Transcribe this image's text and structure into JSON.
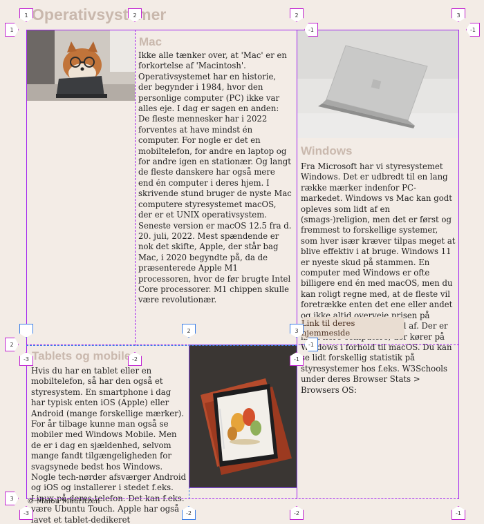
{
  "page": {
    "title": "Operativsystemer",
    "footer": "© Malou Mauritzen"
  },
  "mac": {
    "heading": "Mac",
    "text": "Ikke alle tænker over, at 'Mac' er en forkortelse af 'Macintosh'. Operativsystemet har en historie, der begynder i 1984, hvor den personlige computer (PC) ikke var alles eje. I dag er sagen en anden: De fleste mennesker har i 2022 forventes at have mindst én computer. For nogle er det en mobiltelefon, for andre en laptop og for andre igen en stationær. Og langt de fleste danskere har også mere end én computer i deres hjem. I skrivende stund bruger de nyste Mac computere styresystemet macOS, der er et UNIX operativsystem. Seneste version er macOS 12.5 fra d. 20. juli, 2022. Mest spændende er nok det skifte, Apple, der står bag Mac, i 2020 begyndte på, da de præsenterede Apple M1 processoren, hvor de før brugte Intel Core processorer. M1 chippen skulle være revolutionær."
  },
  "windows": {
    "heading": "Windows",
    "text": "Fra Microsoft har vi styresystemet Windows. Det er udbredt til en lang række mærker indenfor PC-markedet. Windows vs Mac kan godt opleves som lidt af en (smags-)religion, men det er først og fremmest to forskellige systemer, som hver især kræver tilpas meget at blive effektiv i at bruge. Windows 11 er nyeste skud på stammen. En computer med Windows er ofte billigere end én med macOS, men du kan roligt regne med, at de fleste vil foretrække enten det ene eller andet og ikke altid overveje prisen på systemet, de bliver en del af. Der er klart flere computere, der kører på Windows i forhold til macOS. Du kan se lidt forskellig statistik på styresystemer hos f.eks. W3Schools under deres Browser Stats > Browsers OS:",
    "link_label": "Link til deres hjemmeside"
  },
  "tablets": {
    "heading": "Tablets og mobile",
    "text": "Hvis du har en tablet eller en mobiltelefon, så har den også et styresystem. En smartphone i dag har typisk enten iOS (Apple) eller Android (mange forskellige mærker). For år tilbage kunne man også se mobiler med Windows Mobile. Men de er i dag en sjældenhed, selvom mange fandt tilgængeligheden for svagsynede bedst hos Windows. Nogle tech-nørder afsværger Android og iOS og installerer i stedet f.eks. Linux på deres telefon. Det kan f.eks. være Ubuntu Touch. Apple har også lavet et tablet-dedikeret operativsystem, de kalder iPadOS."
  },
  "grid_tags": {
    "t1": "1",
    "t2": "2",
    "t3": "3",
    "m1": "-1",
    "m2": "-2",
    "m3": "-3"
  },
  "colors": {
    "background": "#f3ece6",
    "heading": "#c9b8ad",
    "grid_purple": "#a020f0",
    "grid_blue": "#3a7ee6",
    "link_bg": "#e9ddd2"
  }
}
